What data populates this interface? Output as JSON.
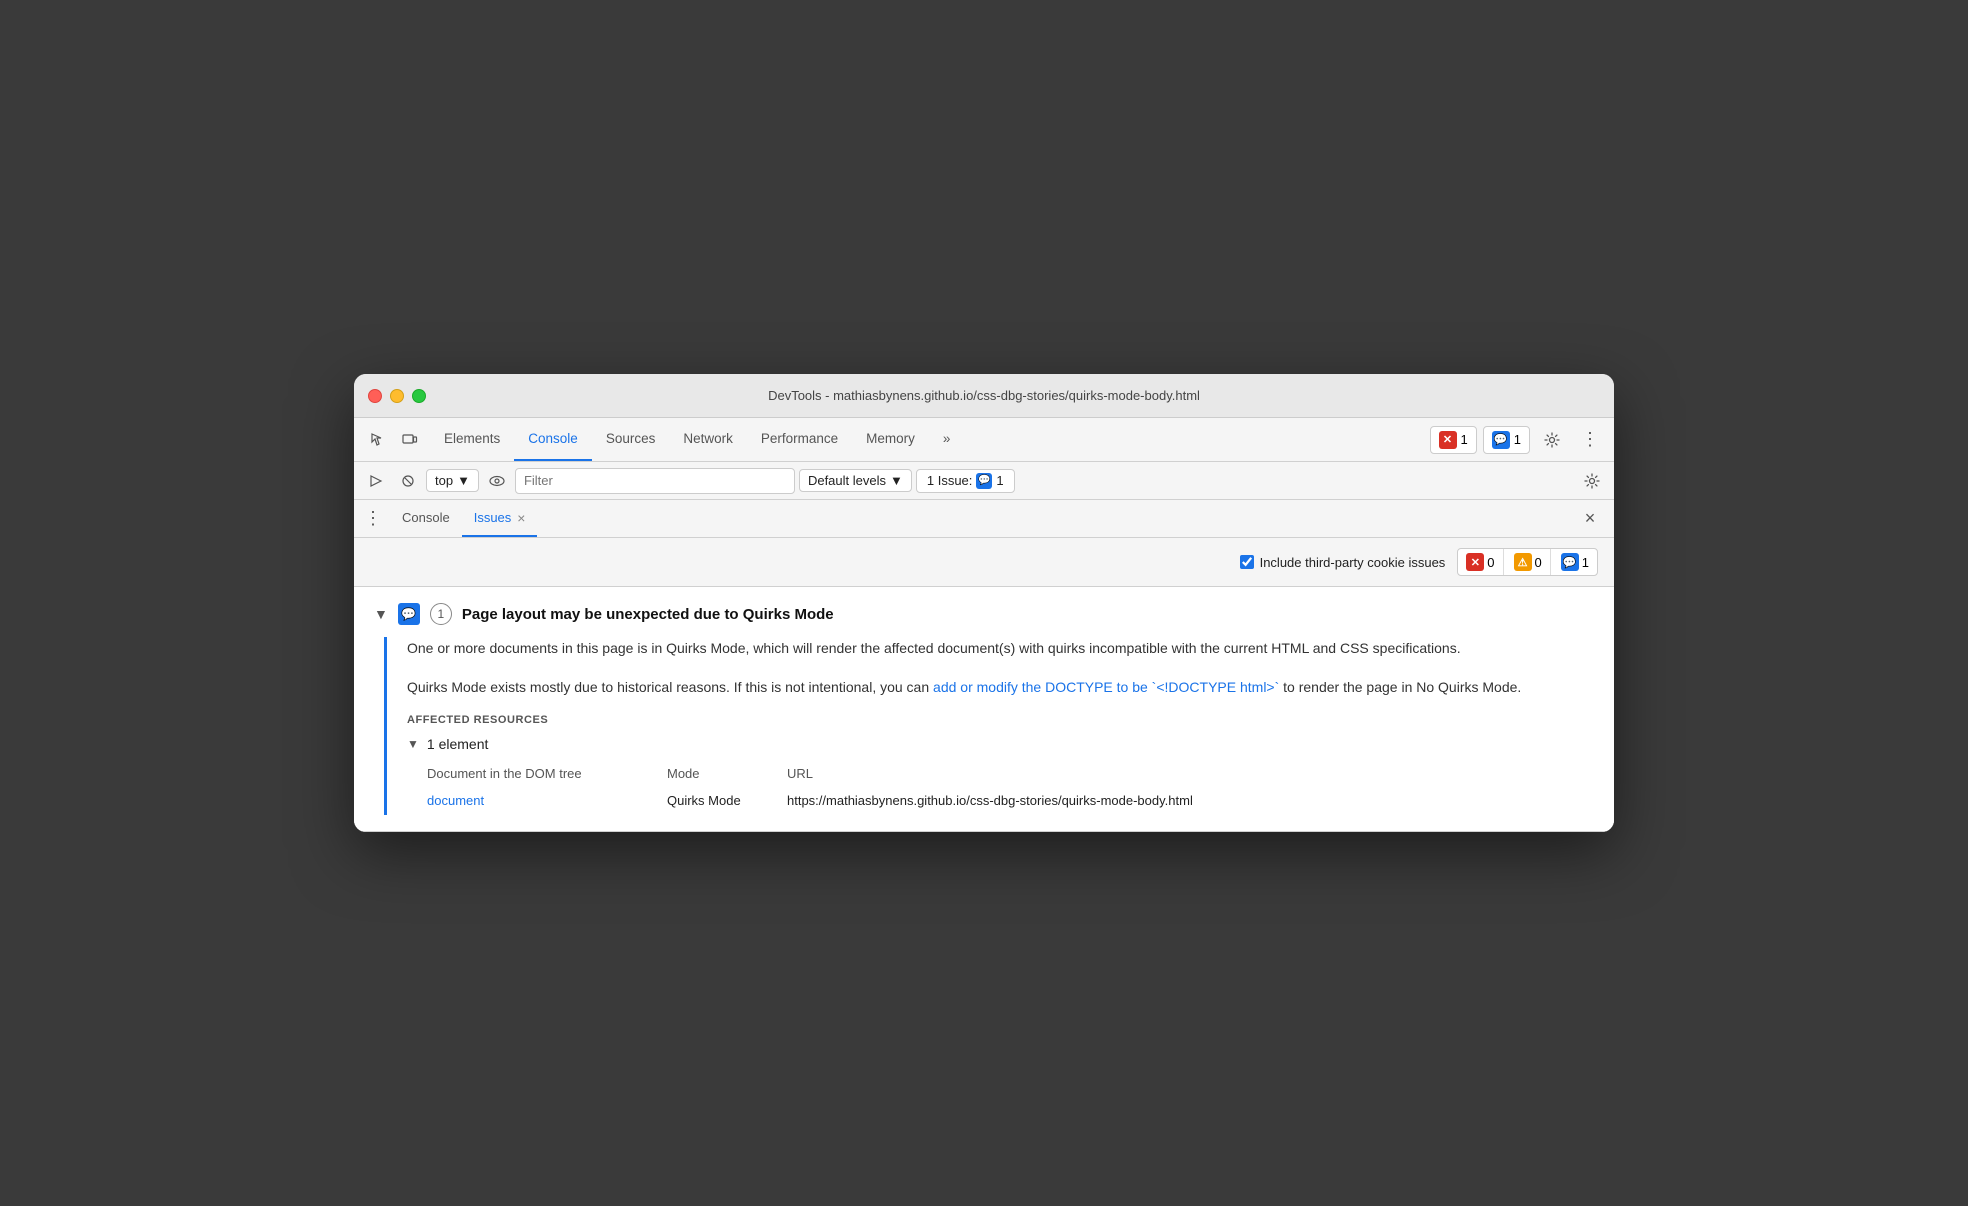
{
  "window": {
    "title": "DevTools - mathiasbynens.github.io/css-dbg-stories/quirks-mode-body.html"
  },
  "toolbar": {
    "tabs": [
      {
        "id": "elements",
        "label": "Elements",
        "active": false
      },
      {
        "id": "console",
        "label": "Console",
        "active": true
      },
      {
        "id": "sources",
        "label": "Sources",
        "active": false
      },
      {
        "id": "network",
        "label": "Network",
        "active": false
      },
      {
        "id": "performance",
        "label": "Performance",
        "active": false
      },
      {
        "id": "memory",
        "label": "Memory",
        "active": false
      }
    ],
    "more_label": "»",
    "error_count": "1",
    "message_count": "1"
  },
  "console_toolbar": {
    "top_label": "top",
    "filter_placeholder": "Filter",
    "levels_label": "Default levels",
    "issue_label": "1 Issue:",
    "issue_count": "1"
  },
  "issues_panel": {
    "tabs": [
      {
        "id": "console",
        "label": "Console",
        "closeable": false,
        "active": false
      },
      {
        "id": "issues",
        "label": "Issues",
        "closeable": true,
        "active": true
      }
    ],
    "filter": {
      "checkbox_label": "Include third-party cookie issues",
      "checked": true,
      "counts": [
        {
          "type": "red",
          "value": "0"
        },
        {
          "type": "yellow",
          "value": "0"
        },
        {
          "type": "blue",
          "value": "1"
        }
      ]
    },
    "issue": {
      "title": "Page layout may be unexpected due to Quirks Mode",
      "count": "1",
      "description_p1": "One or more documents in this page is in Quirks Mode, which will render the affected document(s) with quirks incompatible with the current HTML and CSS specifications.",
      "description_p2_before": "Quirks Mode exists mostly due to historical reasons. If this is not intentional, you can ",
      "description_p2_link": "add or modify the DOCTYPE to be `<!DOCTYPE html>`",
      "description_p2_after": " to render the page in No Quirks Mode.",
      "affected_label": "Affected Resources",
      "element_count_label": "1 element",
      "table_headers": [
        "Document in the DOM tree",
        "Mode",
        "URL"
      ],
      "table_rows": [
        {
          "col1_link": "document",
          "col1_link_href": "#",
          "col2": "Quirks Mode",
          "col3": "https://mathiasbynens.github.io/css-dbg-stories/quirks-mode-body.html"
        }
      ]
    }
  }
}
